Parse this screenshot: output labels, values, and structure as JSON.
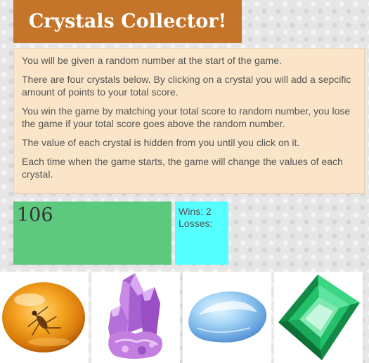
{
  "header": {
    "title": "Crystals Collector!"
  },
  "instructions": [
    "You will be given a random number at the start of the game.",
    "There are four crystals below. By clicking on a crystal you will add a sepcific amount of points to your total score.",
    "You win the game by matching your total score to random number, you lose the game if your total score goes above the random number.",
    "The value of each crystal is hidden from you until you click on it.",
    "Each time when the game starts, the game will change the values of each crystal."
  ],
  "score": {
    "random_number": "106"
  },
  "stats": {
    "wins_label": "Wins:",
    "wins_value": "2",
    "losses_label": "Losses:",
    "losses_value": ""
  },
  "crystals": [
    {
      "name": "amber",
      "icon": "amber-crystal-icon",
      "color": "#f29a1a"
    },
    {
      "name": "amethyst",
      "icon": "amethyst-crystal-icon",
      "color": "#b06ad0"
    },
    {
      "name": "blue-topaz",
      "icon": "blue-crystal-icon",
      "color": "#8fc8f2"
    },
    {
      "name": "emerald",
      "icon": "emerald-crystal-icon",
      "color": "#1fba62"
    }
  ],
  "colors": {
    "title_bg": "#c5752a",
    "instructions_bg": "#fbe5c9",
    "score_bg": "#5cc97f",
    "stats_bg": "#55ffff"
  }
}
